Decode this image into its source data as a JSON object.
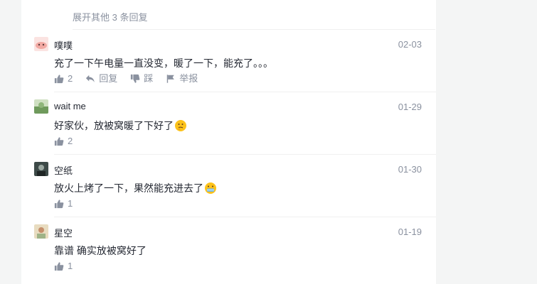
{
  "thread": {
    "expand_label": "展开其他 3 条回复"
  },
  "comments": [
    {
      "user": "噗噗",
      "date": "02-03",
      "text": "充了一下午电量一直没变，暖了一下，能充了。。。",
      "likes": "2",
      "reply_label": "回复",
      "dislike_label": "踩",
      "report_label": "举报",
      "avatar_color": "#f4c9c6"
    },
    {
      "user": "wait me",
      "date": "01-29",
      "text": "好家伙，放被窝暖了下好了",
      "emoji": "thinking-face-emoji",
      "likes": "2",
      "avatar_color": "#7aa36a"
    },
    {
      "user": "空纸",
      "date": "01-30",
      "text": "放火上烤了一下，果然能充进去了",
      "emoji": "grimacing-emoji",
      "likes": "1",
      "avatar_color": "#2f3a3a"
    },
    {
      "user": "星空",
      "date": "01-19",
      "text": "靠谱 确实放被窝好了",
      "likes": "1",
      "avatar_color": "#c9b78f"
    }
  ],
  "icons": {
    "like": "thumbs-up-icon",
    "reply": "reply-arrow-icon",
    "dislike": "thumbs-down-icon",
    "report": "flag-icon"
  },
  "colors": {
    "text": "#252933",
    "muted": "#8a919f",
    "background": "#f4f5f5",
    "panel": "#ffffff"
  }
}
